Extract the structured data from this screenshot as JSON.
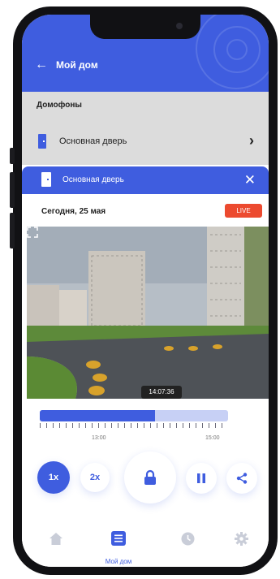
{
  "header": {
    "title": "Мой дом"
  },
  "intercoms": {
    "section_title": "Домофоны",
    "items": [
      {
        "label": "Основная дверь"
      }
    ]
  },
  "camera_sheet": {
    "title": "Основная дверь",
    "date": "Сегодня, 25 мая",
    "live_label": "LIVE",
    "timestamp": "14:07:36"
  },
  "timeline": {
    "progress": 0.61,
    "labels": [
      "13:00",
      "15:00"
    ]
  },
  "controls": {
    "speed_1x": "1x",
    "speed_2x": "2x",
    "selected_speed": "1x"
  },
  "bottom_nav": {
    "items": [
      {
        "icon": "home-icon"
      },
      {
        "icon": "list-icon",
        "label": "Мой дом",
        "active": true
      },
      {
        "icon": "clock-icon"
      },
      {
        "icon": "gear-icon"
      }
    ]
  },
  "colors": {
    "accent": "#3f5ddf",
    "live": "#ec4a2f"
  }
}
